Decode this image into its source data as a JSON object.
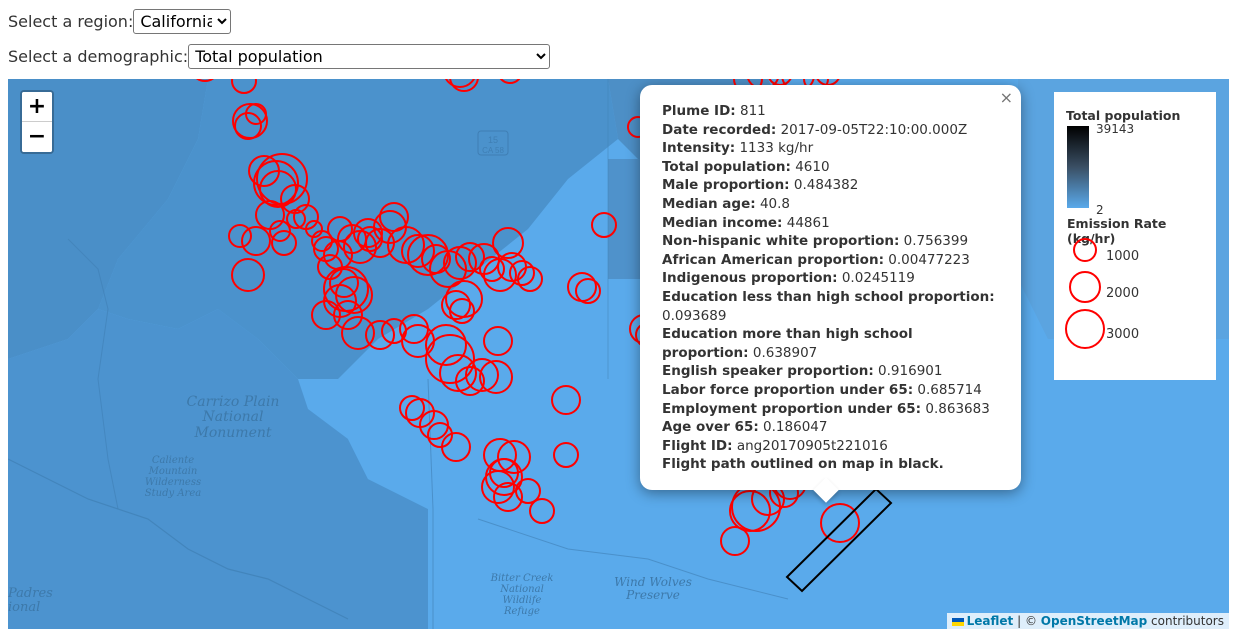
{
  "controls": {
    "region_label": "Select a region:",
    "region_value": "California",
    "demographic_label": "Select a demographic:",
    "demographic_value": "Total population"
  },
  "map": {
    "zoom_in": "+",
    "zoom_out": "−",
    "fill_color": "#5aaaeb",
    "plume_color": "#ff0000",
    "labels": {
      "carrizo": "Carrizo Plain National Monument",
      "caliente": "Caliente Mountain Wilderness Study Area",
      "bitter": "Bitter Creek National Wildlife Refuge",
      "windwolves": "Wind Wolves Preserve",
      "padres": "Padres ional",
      "hwy": "15 CA 58"
    }
  },
  "popup": {
    "close": "×",
    "rows": [
      {
        "k": "Plume ID:",
        "v": "811"
      },
      {
        "k": "Date recorded:",
        "v": "2017-09-05T22:10:00.000Z"
      },
      {
        "k": "Intensity:",
        "v": "1133 kg/hr"
      },
      {
        "k": "Total population:",
        "v": "4610"
      },
      {
        "k": "Male proportion:",
        "v": "0.484382"
      },
      {
        "k": "Median age:",
        "v": "40.8"
      },
      {
        "k": "Median income:",
        "v": "44861"
      },
      {
        "k": "Non-hispanic white proportion:",
        "v": "0.756399"
      },
      {
        "k": "African American proportion:",
        "v": "0.00477223"
      },
      {
        "k": "Indigenous proportion:",
        "v": "0.0245119"
      },
      {
        "k": "Education less than high school proportion:",
        "v": "0.093689"
      },
      {
        "k": "Education more than high school proportion:",
        "v": "0.638907"
      },
      {
        "k": "English speaker proportion:",
        "v": "0.916901"
      },
      {
        "k": "Labor force proportion under 65:",
        "v": "0.685714"
      },
      {
        "k": "Employment proportion under 65:",
        "v": "0.863683"
      },
      {
        "k": "Age over 65:",
        "v": "0.186047"
      },
      {
        "k": "Flight ID:",
        "v": "ang20170905t221016"
      }
    ],
    "footer": "Flight path outlined on map in black."
  },
  "legend": {
    "title": "Total population",
    "max": "39143",
    "min": "2",
    "emission_title": "Emission Rate (kg/hr)",
    "levels": [
      "1000",
      "2000",
      "3000"
    ]
  },
  "attribution": {
    "leaflet": "Leaflet",
    "sep": " | © ",
    "osm": "OpenStreetMap",
    "tail": " contributors"
  }
}
